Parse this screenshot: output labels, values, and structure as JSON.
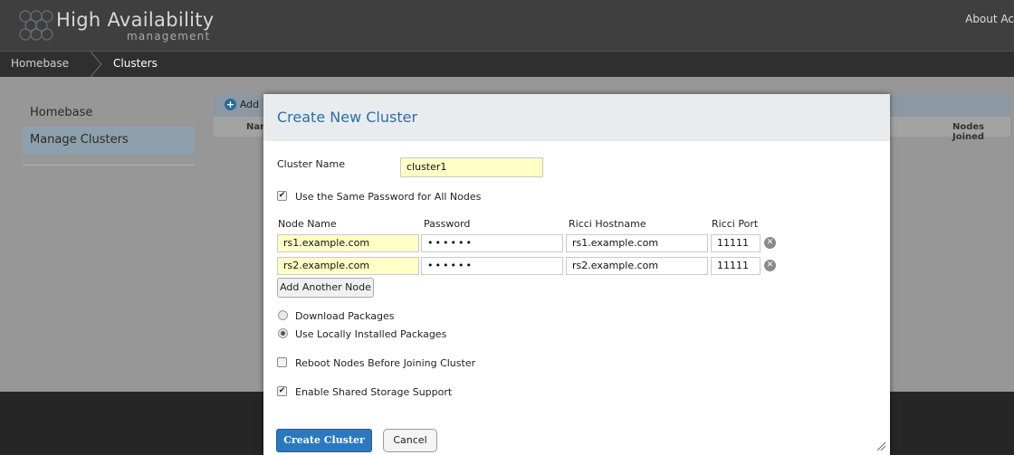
{
  "app": {
    "title": "High Availability",
    "subtitle": "management",
    "top_link": "About  Ac"
  },
  "breadcrumb": [
    "Homebase",
    "Clusters"
  ],
  "sidebar": {
    "items": [
      {
        "label": "Homebase",
        "active": false
      },
      {
        "label": "Manage Clusters",
        "active": true
      }
    ]
  },
  "grid": {
    "add_label": "Add",
    "col_name": "Nar",
    "col_nodes_joined": "Nodes Joined"
  },
  "modal": {
    "title": "Create New Cluster",
    "cluster_name_label": "Cluster Name",
    "cluster_name_value": "cluster1",
    "same_password_label": "Use the Same Password for All Nodes",
    "same_password_checked": true,
    "columns": {
      "node_name": "Node Name",
      "password": "Password",
      "ricci_hostname": "Ricci Hostname",
      "ricci_port": "Ricci Port"
    },
    "nodes": [
      {
        "node_name": "rs1.example.com",
        "password": "••••••",
        "ricci_hostname": "rs1.example.com",
        "ricci_port": "11111"
      },
      {
        "node_name": "rs2.example.com",
        "password": "••••••",
        "ricci_hostname": "rs2.example.com",
        "ricci_port": "11111"
      }
    ],
    "add_node_label": "Add Another Node",
    "package_options": [
      {
        "label": "Download Packages",
        "selected": false
      },
      {
        "label": "Use Locally Installed Packages",
        "selected": true
      }
    ],
    "reboot_label": "Reboot Nodes Before Joining Cluster",
    "reboot_checked": false,
    "shared_storage_label": "Enable Shared Storage Support",
    "shared_storage_checked": true,
    "create_label": "Create Cluster",
    "cancel_label": "Cancel"
  },
  "colors": {
    "accent": "#2b78c0",
    "title": "#2a6fa8",
    "required_field": "#ffffc6",
    "topbar": "#3f3f3f",
    "overlay": "#979797"
  }
}
